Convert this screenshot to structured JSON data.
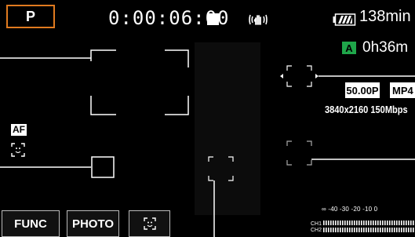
{
  "mode": "P",
  "timecode": "0:00:06:00",
  "battery": {
    "time": "138min"
  },
  "media": {
    "slot": "A",
    "remaining": "0h36m"
  },
  "recording": {
    "frame_rate": "50.00P",
    "format": "MP4",
    "resolution": "3840x2160 150Mbps"
  },
  "af": {
    "label": "AF"
  },
  "buttons": {
    "func": "FUNC",
    "photo": "PHOTO"
  },
  "audio": {
    "scale": "∞ -40  -30   -20   -10   0",
    "ch1": "CH1",
    "ch2": "CH2"
  },
  "colors": {
    "mode_border": "#e07a1f",
    "card_badge": "#1fa64a"
  },
  "icons": [
    "stop-icon",
    "image-stabilizer-icon",
    "battery-icon",
    "face-detection-icon",
    "touch-af-frame-icon"
  ]
}
